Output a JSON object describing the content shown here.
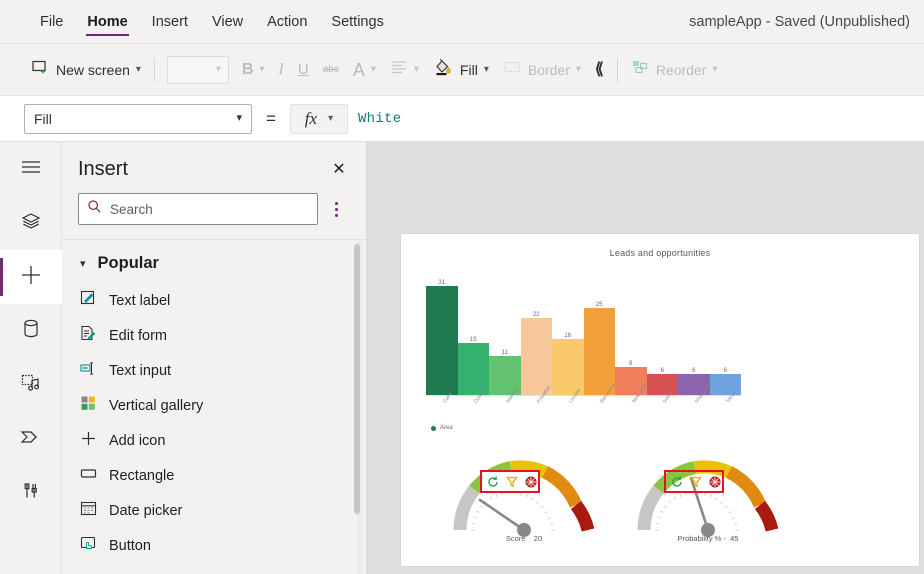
{
  "window": {
    "app_title": "sampleApp - Saved (Unpublished)"
  },
  "menu": {
    "items": [
      {
        "label": "File",
        "active": false
      },
      {
        "label": "Home",
        "active": true
      },
      {
        "label": "Insert",
        "active": false
      },
      {
        "label": "View",
        "active": false
      },
      {
        "label": "Action",
        "active": false
      },
      {
        "label": "Settings",
        "active": false
      }
    ]
  },
  "ribbon": {
    "new_screen": "New screen",
    "font_value": "",
    "bold": "B",
    "italic": "I",
    "underline": "U",
    "strikethrough": "abc",
    "font_color": "A",
    "align": "align-icon",
    "fill": "Fill",
    "border": "Border",
    "expand": "chevron-down",
    "reorder": "Reorder"
  },
  "formula_bar": {
    "property": "Fill",
    "equals": "=",
    "fx": "fx",
    "value": "White"
  },
  "rail": {
    "items": [
      {
        "name": "menu",
        "icon": "hamburger-icon",
        "selected": false
      },
      {
        "name": "tree-view",
        "icon": "layers-icon",
        "selected": false
      },
      {
        "name": "insert",
        "icon": "plus-icon",
        "selected": true
      },
      {
        "name": "data",
        "icon": "database-icon",
        "selected": false
      },
      {
        "name": "media",
        "icon": "media-icon",
        "selected": false
      },
      {
        "name": "power-automate",
        "icon": "flow-icon",
        "selected": false
      },
      {
        "name": "variables",
        "icon": "tools-icon",
        "selected": false
      }
    ]
  },
  "insert_panel": {
    "title": "Insert",
    "close": "✕",
    "search_placeholder": "Search",
    "group": {
      "label": "Popular",
      "expanded": true
    },
    "items": [
      {
        "label": "Text label",
        "icon": "text-label-icon"
      },
      {
        "label": "Edit form",
        "icon": "edit-form-icon"
      },
      {
        "label": "Text input",
        "icon": "text-input-icon"
      },
      {
        "label": "Vertical gallery",
        "icon": "vertical-gallery-icon"
      },
      {
        "label": "Add icon",
        "icon": "add-icon"
      },
      {
        "label": "Rectangle",
        "icon": "rectangle-icon"
      },
      {
        "label": "Date picker",
        "icon": "date-picker-icon"
      },
      {
        "label": "Button",
        "icon": "button-icon"
      }
    ]
  },
  "chart_data": {
    "type": "bar",
    "title": "Leads and opportunities",
    "xlabel": "",
    "ylabel": "",
    "ylim": [
      0,
      34
    ],
    "grid": false,
    "legend_position": "bottom-left",
    "legend": [
      {
        "label": "Area",
        "color": "#1e7b4f"
      }
    ],
    "categories": [
      "Cairo",
      "Dubai",
      "Istanbul",
      "Frankfurt",
      "London",
      "Barcelona",
      "New York",
      "Seoul",
      "Shanghai",
      "Tokyo"
    ],
    "values": [
      31,
      15,
      11,
      22,
      16,
      25,
      8,
      6,
      6,
      6
    ],
    "colors": [
      "#1e7b4f",
      "#35b170",
      "#63c270",
      "#f7c99a",
      "#fbc96b",
      "#f2a03c",
      "#ef7e5a",
      "#d65252",
      "#8e64b0",
      "#6fa3de"
    ]
  },
  "gauges": [
    {
      "name": "score-gauge",
      "caption": "Score    20",
      "value": 20,
      "max": 100,
      "needle_angle": -52,
      "highlight_color": "#e81123",
      "icons": [
        {
          "name": "refresh-icon",
          "color": "#2aa14a"
        },
        {
          "name": "filter-icon",
          "color": "#e8b30a"
        },
        {
          "name": "focus-mode-icon",
          "color": "#c7302b"
        }
      ]
    },
    {
      "name": "probability-gauge",
      "caption": "Probability % -  45",
      "value": 45,
      "max": 100,
      "needle_angle": -18,
      "highlight_color": "#e81123",
      "icons": [
        {
          "name": "refresh-icon",
          "color": "#2aa14a"
        },
        {
          "name": "filter-icon",
          "color": "#e8b30a"
        },
        {
          "name": "focus-mode-icon",
          "color": "#c7302b"
        }
      ]
    }
  ],
  "gauge_arc_colors": [
    "#c8c6c4",
    "#8ac33e",
    "#e8c30a",
    "#e08a10",
    "#a81a10"
  ],
  "theme": {
    "accent": "#742774",
    "formula_text": "#0f7b7b",
    "highlight": "#e81123"
  }
}
